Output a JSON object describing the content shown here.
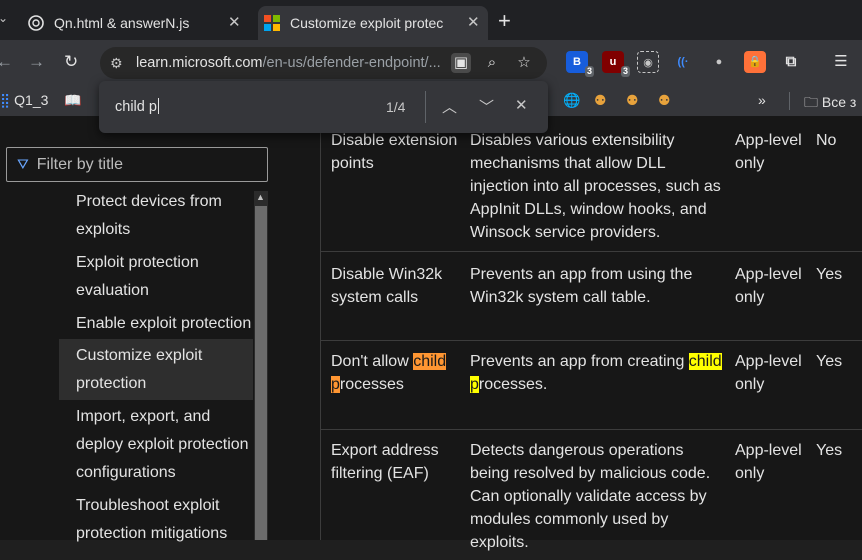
{
  "tabs": [
    {
      "title": "Qn.html & answerN.js",
      "active": false
    },
    {
      "title": "Customize exploit protec",
      "active": true
    }
  ],
  "toolbar": {
    "url_host": "learn.microsoft.com",
    "url_path": "/en-us/defender-endpoint/..."
  },
  "extensions": {
    "badge1": "3",
    "badge2": "3"
  },
  "bookmarks": {
    "first": "Q1_3",
    "folder": "Все з"
  },
  "find": {
    "query": "child p",
    "count": "1/4"
  },
  "sidebar": {
    "filter_placeholder": "Filter by title",
    "items": [
      {
        "label": "Protect devices from exploits"
      },
      {
        "label": "Exploit protection evaluation"
      },
      {
        "label": "Enable exploit protection"
      },
      {
        "label": "Customize exploit protection"
      },
      {
        "label": "Import, export, and deploy exploit protection configurations"
      },
      {
        "label": "Troubleshoot exploit protection mitigations"
      }
    ]
  },
  "table": {
    "rows": [
      {
        "name": "Disable extension points",
        "desc": "Disables various extensibility mechanisms that allow DLL injection into all processes, such as AppInit DLLs, window hooks, and Winsock service providers.",
        "scope": "App-level only",
        "audit": "No"
      },
      {
        "name": "Disable Win32k system calls",
        "desc": "Prevents an app from using the Win32k system call table.",
        "scope": "App-level only",
        "audit": "Yes"
      },
      {
        "name_pre": "Don't allow ",
        "name_hit": "child p",
        "name_post": "rocesses",
        "desc_pre": "Prevents an app from creating ",
        "desc_hit": "child p",
        "desc_post": "rocesses.",
        "scope": "App-level only",
        "audit": "Yes"
      },
      {
        "name": "Export address filtering (EAF)",
        "desc": "Detects dangerous operations being resolved by malicious code. Can optionally validate access by modules commonly used by exploits.",
        "scope": "App-level only",
        "audit": "Yes"
      }
    ]
  },
  "colors": {
    "current_match": "#ff9632",
    "other_match": "#ffff00",
    "accent": "#6aa7ff"
  }
}
